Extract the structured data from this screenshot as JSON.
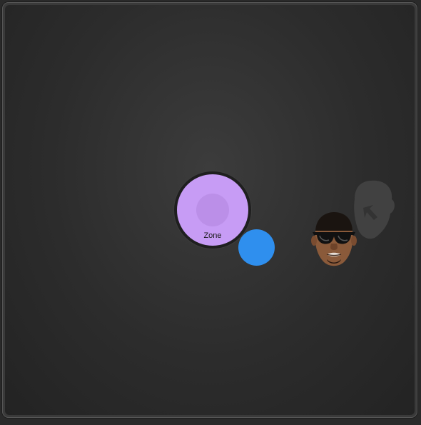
{
  "game": {
    "zone_label": "Zone"
  },
  "icons": {
    "ghost": "ghost-head-arrow-icon",
    "opponent": "sunglasses-face-avatar"
  },
  "colors": {
    "zone": "#c79cf5",
    "zone_core": "#bb8fe8",
    "player": "#2f8fee",
    "board": "#2c2c2c"
  }
}
